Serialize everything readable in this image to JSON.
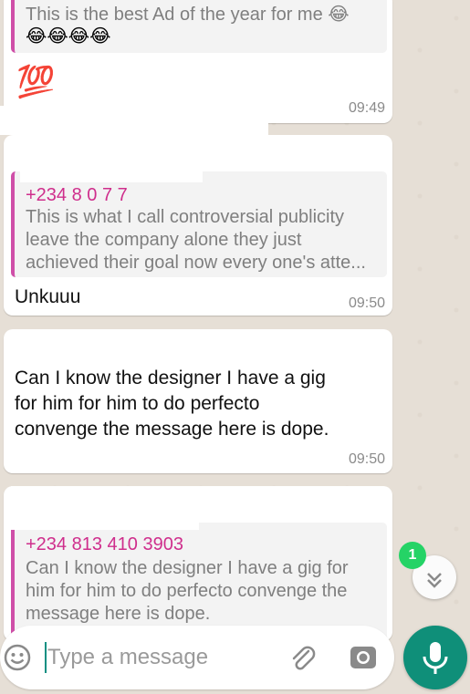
{
  "messages": [
    {
      "quote_text": "This is the best Ad of the year for me 😂",
      "quote_emojis": "😂😂😂😂",
      "body": "💯",
      "time": "09:49"
    },
    {
      "quote_sender": "+234 8 0 7 7",
      "quote_text": "This is what I call controversial publicity leave the company alone they just achieved their goal now every one's atte...",
      "body": "Unkuuu",
      "time": "09:50"
    },
    {
      "body": "Can I know the designer I have a gig for him for him to do perfecto convenge the message here is dope.",
      "time": "09:50"
    },
    {
      "quote_sender": "+234 813 410 3903",
      "quote_text": "Can I know the designer I have a gig for him for him to do perfecto convenge the message here is dope."
    }
  ],
  "unread_badge": "1",
  "composer": {
    "placeholder": "Type a message"
  },
  "icons": {
    "emoji": "emoji-icon",
    "attach": "paperclip-icon",
    "camera": "camera-icon",
    "mic": "mic-icon",
    "scroll": "chevron-double-down-icon"
  },
  "colors": {
    "accent": "#0f8f79",
    "badge": "#25d366",
    "quote_bar": "#cf4fa8",
    "sender": "#cf2e8c"
  }
}
